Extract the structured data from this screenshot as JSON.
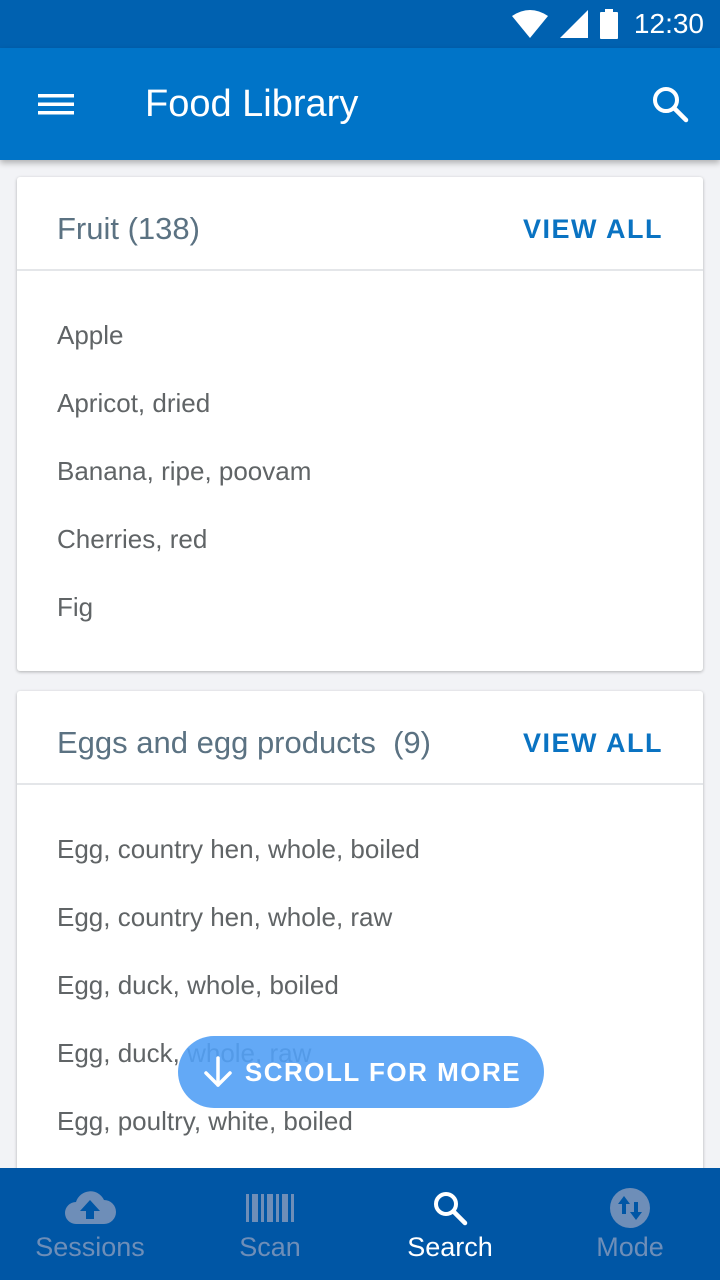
{
  "status_bar": {
    "time": "12:30"
  },
  "app_bar": {
    "title": "Food Library"
  },
  "sections": [
    {
      "title": "Fruit (138)",
      "action": "VIEW ALL",
      "items": [
        "Apple",
        "Apricot, dried",
        "Banana, ripe, poovam",
        "Cherries, red",
        "Fig"
      ]
    },
    {
      "title": "Eggs and egg products  (9)",
      "action": "VIEW ALL",
      "items": [
        "Egg, country hen, whole, boiled",
        "Egg, country hen, whole, raw",
        "Egg, duck, whole, boiled",
        "Egg, duck, whole, raw",
        "Egg, poultry, white, boiled"
      ]
    }
  ],
  "scroll_hint": {
    "label": "SCROLL FOR MORE"
  },
  "bottom_nav": {
    "items": [
      {
        "label": "Sessions",
        "icon": "cloud-upload-icon",
        "active": false
      },
      {
        "label": "Scan",
        "icon": "barcode-icon",
        "active": false
      },
      {
        "label": "Search",
        "icon": "search-icon",
        "active": true
      },
      {
        "label": "Mode",
        "icon": "swap-vertical-icon",
        "active": false
      }
    ]
  },
  "colors": {
    "status_bar": "#0061b0",
    "app_bar": "#0074c8",
    "bottom_nav": "#0056a5",
    "accent": "#0a73c2",
    "scroll_pill": "#52a0f5",
    "nav_inactive": "#6e8eb8"
  }
}
